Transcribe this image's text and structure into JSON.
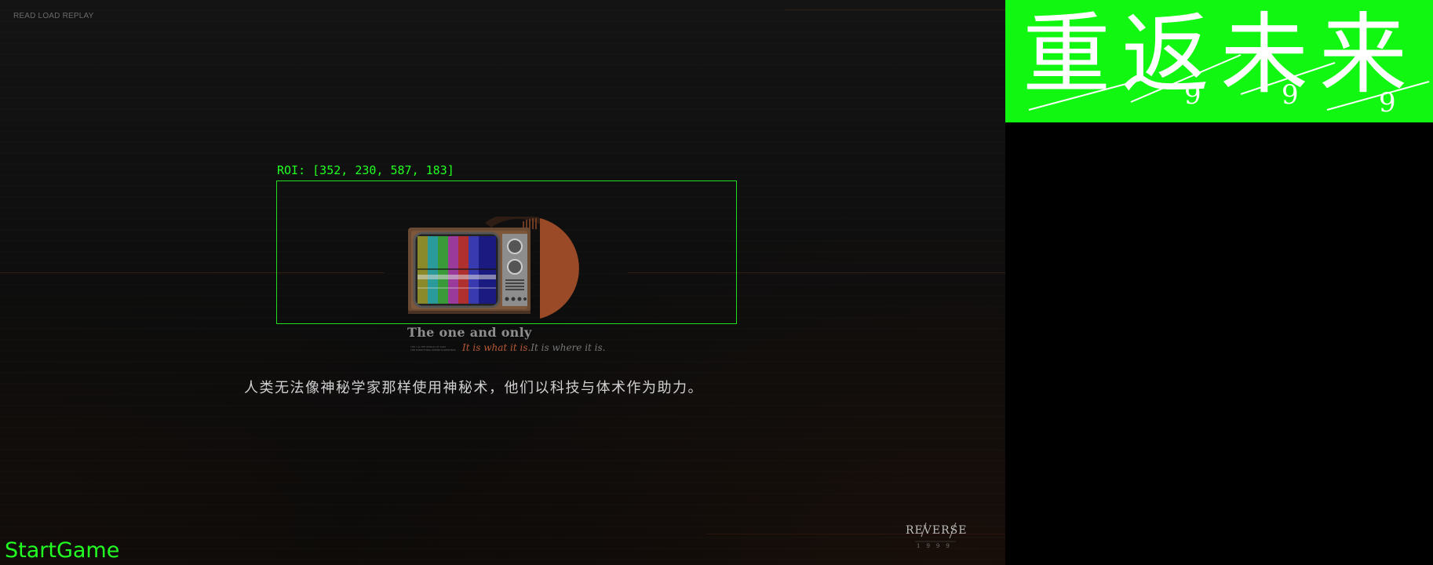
{
  "top_menu": {
    "label": "READ LOAD REPLAY"
  },
  "roi": {
    "label": "ROI: [352, 230, 587, 183]"
  },
  "scene": {
    "tagline": "The one and only",
    "motto_part1": "It is what it is.",
    "motto_part2": "It is where it is.",
    "fine_print": [
      "THE 1 & THE WORLD OF 1999",
      "THE EVERYTHING WHERE ELSEWHERE"
    ]
  },
  "dialogue": {
    "subtitle": "人类无法像神秘学家那样使用神秘术，他们以科技与体术作为助力。"
  },
  "logo": {
    "word": "REVERSE",
    "year": "1999"
  },
  "status": {
    "start_game": "StartGame"
  },
  "banner": {
    "title": "重返未来",
    "subscript": "9",
    "background_color": "#11f711"
  },
  "colors": {
    "accent_green": "#22ff22",
    "motto_orange": "#b85a36"
  }
}
